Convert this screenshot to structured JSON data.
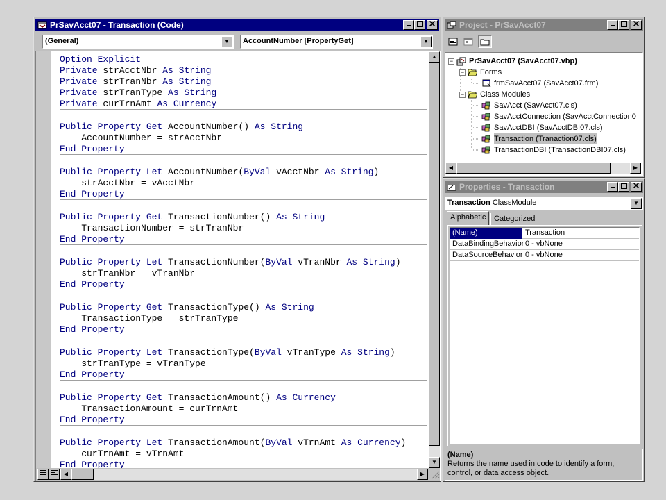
{
  "code_window": {
    "title": "PrSavAcct07 - Transaction (Code)",
    "object_combo": "(General)",
    "procedure_combo": "AccountNumber [PropertyGet]",
    "blocks": [
      [
        [
          {
            "t": "Option Explicit",
            "k": true
          }
        ],
        [
          {
            "t": "Private ",
            "k": true
          },
          {
            "t": "strAcctNbr "
          },
          {
            "t": "As String",
            "k": true
          }
        ],
        [
          {
            "t": "Private ",
            "k": true
          },
          {
            "t": "strTranNbr "
          },
          {
            "t": "As String",
            "k": true
          }
        ],
        [
          {
            "t": "Private ",
            "k": true
          },
          {
            "t": "strTranType "
          },
          {
            "t": "As String",
            "k": true
          }
        ],
        [
          {
            "t": "Private ",
            "k": true
          },
          {
            "t": "curTrnAmt "
          },
          {
            "t": "As Currency",
            "k": true
          }
        ]
      ],
      [
        [
          {
            "t": "Public Property Get ",
            "k": true
          },
          {
            "t": "AccountNumber() "
          },
          {
            "t": "As String",
            "k": true
          }
        ],
        [
          {
            "t": "    AccountNumber = strAcctNbr"
          }
        ],
        [
          {
            "t": "End Property",
            "k": true
          }
        ]
      ],
      [
        [
          {
            "t": "Public Property Let ",
            "k": true
          },
          {
            "t": "AccountNumber("
          },
          {
            "t": "ByVal ",
            "k": true
          },
          {
            "t": "vAcctNbr "
          },
          {
            "t": "As String",
            "k": true
          },
          {
            "t": ")"
          }
        ],
        [
          {
            "t": "    strAcctNbr = vAcctNbr"
          }
        ],
        [
          {
            "t": "End Property",
            "k": true
          }
        ]
      ],
      [
        [
          {
            "t": "Public Property Get ",
            "k": true
          },
          {
            "t": "TransactionNumber() "
          },
          {
            "t": "As String",
            "k": true
          }
        ],
        [
          {
            "t": "    TransactionNumber = strTranNbr"
          }
        ],
        [
          {
            "t": "End Property",
            "k": true
          }
        ]
      ],
      [
        [
          {
            "t": "Public Property Let ",
            "k": true
          },
          {
            "t": "TransactionNumber("
          },
          {
            "t": "ByVal ",
            "k": true
          },
          {
            "t": "vTranNbr "
          },
          {
            "t": "As String",
            "k": true
          },
          {
            "t": ")"
          }
        ],
        [
          {
            "t": "    strTranNbr = vTranNbr"
          }
        ],
        [
          {
            "t": "End Property",
            "k": true
          }
        ]
      ],
      [
        [
          {
            "t": "Public Property Get ",
            "k": true
          },
          {
            "t": "TransactionType() "
          },
          {
            "t": "As String",
            "k": true
          }
        ],
        [
          {
            "t": "    TransactionType = strTranType"
          }
        ],
        [
          {
            "t": "End Property",
            "k": true
          }
        ]
      ],
      [
        [
          {
            "t": "Public Property Let ",
            "k": true
          },
          {
            "t": "TransactionType("
          },
          {
            "t": "ByVal ",
            "k": true
          },
          {
            "t": "vTranType "
          },
          {
            "t": "As String",
            "k": true
          },
          {
            "t": ")"
          }
        ],
        [
          {
            "t": "    strTranType = vTranType"
          }
        ],
        [
          {
            "t": "End Property",
            "k": true
          }
        ]
      ],
      [
        [
          {
            "t": "Public Property Get ",
            "k": true
          },
          {
            "t": "TransactionAmount() "
          },
          {
            "t": "As Currency",
            "k": true
          }
        ],
        [
          {
            "t": "    TransactionAmount = curTrnAmt"
          }
        ],
        [
          {
            "t": "End Property",
            "k": true
          }
        ]
      ],
      [
        [
          {
            "t": "Public Property Let ",
            "k": true
          },
          {
            "t": "TransactionAmount("
          },
          {
            "t": "ByVal ",
            "k": true
          },
          {
            "t": "vTrnAmt "
          },
          {
            "t": "As Currency",
            "k": true
          },
          {
            "t": ")"
          }
        ],
        [
          {
            "t": "    curTrnAmt = vTrnAmt"
          }
        ],
        [
          {
            "t": "End Property",
            "k": true
          }
        ]
      ]
    ]
  },
  "project_window": {
    "title": "Project - PrSavAcct07",
    "toolbar": [
      "view-code-icon",
      "view-object-icon",
      "toggle-folders-icon"
    ],
    "tree": {
      "root": "PrSavAcct07 (SavAcct07.vbp)",
      "forms_label": "Forms",
      "forms": [
        "frmSavAcct07 (SavAcct07.frm)"
      ],
      "class_modules_label": "Class Modules",
      "classes": [
        "SavAcct (SavAcct07.cls)",
        "SavAcctConnection (SavAcctConnection0",
        "SavAcctDBI (SavAcctDBI07.cls)",
        "Transaction (Tranaction07.cls)",
        "TransactionDBI (TransactionDBI07.cls)"
      ],
      "selected_index": 3
    }
  },
  "properties_window": {
    "title": "Properties - Transaction",
    "object_name": "Transaction",
    "object_type": "ClassModule",
    "tabs": [
      "Alphabetic",
      "Categorized"
    ],
    "active_tab": 0,
    "rows": [
      {
        "name": "(Name)",
        "value": "Transaction"
      },
      {
        "name": "DataBindingBehavior",
        "value": "0 - vbNone"
      },
      {
        "name": "DataSourceBehavior",
        "value": "0 - vbNone"
      }
    ],
    "description_title": "(Name)",
    "description_text": "Returns the name used in code to identify a form, control, or data access object."
  },
  "colors": {
    "keyword": "#000080",
    "active_title": "#000080",
    "inactive_title": "#808080"
  }
}
